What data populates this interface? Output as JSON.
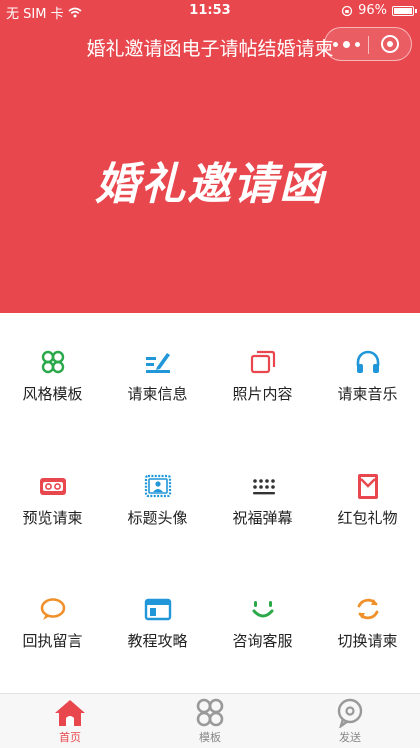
{
  "status_bar": {
    "carrier": "无 SIM 卡",
    "time": "11:53",
    "battery": "96%",
    "battery_level": 0.96
  },
  "header": {
    "title": "婚礼邀请函电子请帖结婚请柬"
  },
  "banner": {
    "text": "婚礼邀请函",
    "background_color": "#e8474e"
  },
  "menu": {
    "items": [
      {
        "label": "风格模板",
        "icon": "four-leaf-icon",
        "color": "#2aa84a"
      },
      {
        "label": "请柬信息",
        "icon": "edit-info-icon",
        "color": "#2196d9"
      },
      {
        "label": "照片内容",
        "icon": "photos-icon",
        "color": "#e8474e"
      },
      {
        "label": "请柬音乐",
        "icon": "headphones-icon",
        "color": "#2196d9"
      },
      {
        "label": "预览请柬",
        "icon": "tape-icon",
        "color": "#e8474e"
      },
      {
        "label": "标题头像",
        "icon": "portrait-icon",
        "color": "#2196d9"
      },
      {
        "label": "祝福弹幕",
        "icon": "dots-grid-icon",
        "color": "#333333"
      },
      {
        "label": "红包礼物",
        "icon": "red-envelope-icon",
        "color": "#e8474e"
      },
      {
        "label": "回执留言",
        "icon": "speech-bubble-icon",
        "color": "#f0902a"
      },
      {
        "label": "教程攻略",
        "icon": "browser-window-icon",
        "color": "#2196d9"
      },
      {
        "label": "咨询客服",
        "icon": "smile-icon",
        "color": "#2aa84a"
      },
      {
        "label": "切换请柬",
        "icon": "refresh-icon",
        "color": "#f0902a"
      }
    ]
  },
  "tabbar": {
    "tabs": [
      {
        "label": "首页",
        "icon": "home-icon",
        "active": true
      },
      {
        "label": "模板",
        "icon": "four-leaf-icon",
        "active": false
      },
      {
        "label": "发送",
        "icon": "send-bubble-icon",
        "active": false
      }
    ],
    "active_color": "#e8474e",
    "inactive_color": "#888888"
  }
}
